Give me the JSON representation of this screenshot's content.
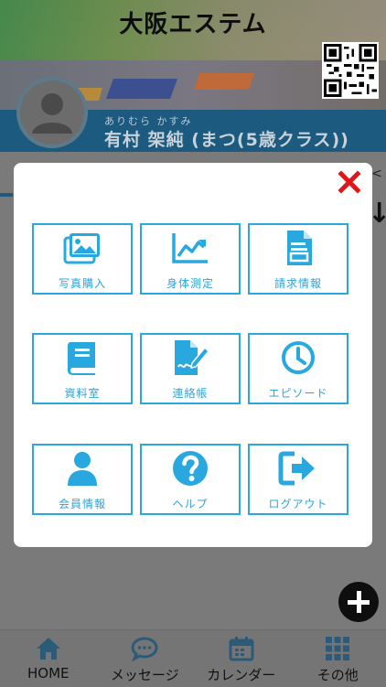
{
  "header": {
    "school_name": "大阪エステム",
    "child_furigana": "ありむら かすみ",
    "child_name": "有村 架純 (まつ(5歳クラス))"
  },
  "modal": {
    "accent_color": "#29a8e0",
    "close_color": "#e0161c",
    "close_icon": "close-icon",
    "tiles": [
      {
        "label": "写真購入",
        "icon": "photo-gallery-icon"
      },
      {
        "label": "身体測定",
        "icon": "line-chart-icon"
      },
      {
        "label": "請求情報",
        "icon": "invoice-document-icon"
      },
      {
        "label": "資料室",
        "icon": "book-icon"
      },
      {
        "label": "連絡帳",
        "icon": "signature-document-icon"
      },
      {
        "label": "エピソード",
        "icon": "clock-icon"
      },
      {
        "label": "会員情報",
        "icon": "user-icon"
      },
      {
        "label": "ヘルプ",
        "icon": "question-circle-icon"
      },
      {
        "label": "ログアウト",
        "icon": "logout-icon"
      }
    ]
  },
  "bottom_nav": {
    "items": [
      {
        "label": "HOME",
        "icon": "home-icon"
      },
      {
        "label": "メッセージ",
        "icon": "chat-icon"
      },
      {
        "label": "カレンダー",
        "icon": "calendar-icon"
      },
      {
        "label": "その他",
        "icon": "grid-icon"
      }
    ]
  }
}
